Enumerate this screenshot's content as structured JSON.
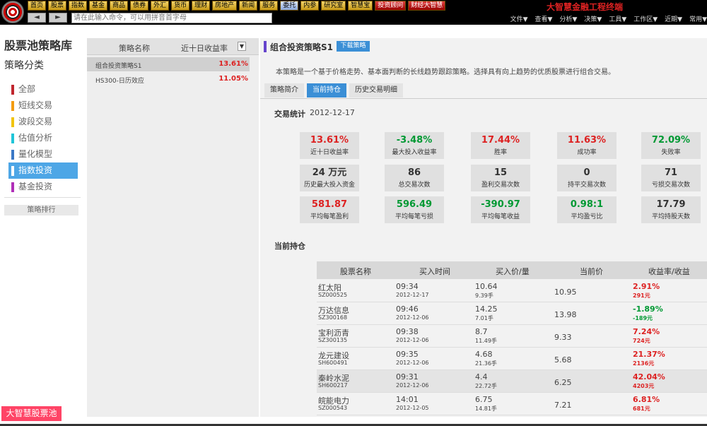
{
  "app": {
    "brand_title": "大智慧金融工程终端",
    "nav_buttons": [
      "首页",
      "股票",
      "指数",
      "基金",
      "商品",
      "债券",
      "外汇",
      "货币",
      "理财",
      "房地产",
      "新闻",
      "服务",
      "委托",
      "内参",
      "研究室",
      "智慧宝",
      "投资顾问",
      "财经大智慧"
    ],
    "command_placeholder": "请在此输入命令，可以用拼音首字母",
    "command_dropdown": "▼",
    "back_arrow": "◄",
    "forward_arrow": "►",
    "menus": [
      "文件▼",
      "查看▼",
      "分析▼",
      "决策▼",
      "工具▼",
      "工作区▼",
      "近期▼",
      "常用▼"
    ]
  },
  "sidebar": {
    "title": "股票池策略库",
    "category_title": "策略分类",
    "categories": [
      {
        "label": "全部",
        "color": "#c0262e"
      },
      {
        "label": "短线交易",
        "color": "#f39c12"
      },
      {
        "label": "波段交易",
        "color": "#f1c40f"
      },
      {
        "label": "估值分析",
        "color": "#1fc5d8"
      },
      {
        "label": "量化模型",
        "color": "#3a78c6"
      },
      {
        "label": "指数投资",
        "color": "#2e5fbf"
      },
      {
        "label": "基金投资",
        "color": "#b02fb8"
      }
    ],
    "rank_button": "策略排行",
    "pool_button": "大智慧股票池"
  },
  "list": {
    "col_name": "策略名称",
    "col_return": "近十日收益率",
    "sort_icon": "▼",
    "rows": [
      {
        "name": "组合投资策略S1",
        "ret": "13.61%"
      },
      {
        "name": "HS300-日历效应",
        "ret": "11.05%"
      }
    ]
  },
  "detail": {
    "title": "组合投资策略S1",
    "download_button": "下载策略",
    "description": "本策略是一个基于价格走势、基本面判断的长线趋势跟踪策略。选择具有向上趋势的优质股票进行组合交易。",
    "tabs": [
      "策略简介",
      "当前持仓",
      "历史交易明细"
    ],
    "stat_label": "交易统计",
    "stat_date": "2012-12-17",
    "stats": [
      {
        "val": "13.61%",
        "lbl": "近十日收益率",
        "cls": "red"
      },
      {
        "val": "-3.48%",
        "lbl": "最大投入收益率",
        "cls": "green"
      },
      {
        "val": "17.44%",
        "lbl": "胜率",
        "cls": "red"
      },
      {
        "val": "11.63%",
        "lbl": "成功率",
        "cls": "red"
      },
      {
        "val": "72.09%",
        "lbl": "失败率",
        "cls": "green"
      },
      {
        "val": "24 万元",
        "lbl": "历史最大投入资金",
        "cls": "dark"
      },
      {
        "val": "86",
        "lbl": "总交易次数",
        "cls": "dark"
      },
      {
        "val": "15",
        "lbl": "盈利交易次数",
        "cls": "dark"
      },
      {
        "val": "0",
        "lbl": "持平交易次数",
        "cls": "dark"
      },
      {
        "val": "71",
        "lbl": "亏损交易次数",
        "cls": "dark"
      },
      {
        "val": "581.87",
        "lbl": "平均每笔盈利",
        "cls": "red"
      },
      {
        "val": "596.49",
        "lbl": "平均每笔亏损",
        "cls": "green"
      },
      {
        "val": "-390.97",
        "lbl": "平均每笔收益",
        "cls": "green"
      },
      {
        "val": "0.98:1",
        "lbl": "平均盈亏比",
        "cls": "green"
      },
      {
        "val": "17.79",
        "lbl": "平均持股天数",
        "cls": "dark"
      }
    ],
    "holdings_label": "当前持仓",
    "holdings_headers": [
      "股票名称",
      "买入时间",
      "买入价/量",
      "当前价",
      "收益率/收益"
    ],
    "holdings": [
      {
        "name": "红太阳",
        "code": "SZ000525",
        "time": "09:34",
        "date": "2012-12-17",
        "price": "10.64",
        "qty": "9.39手",
        "cur": "10.95",
        "rate": "2.91%",
        "amt": "291元",
        "cls": "red"
      },
      {
        "name": "万达信息",
        "code": "SZ300168",
        "time": "09:46",
        "date": "2012-12-06",
        "price": "14.25",
        "qty": "7.01手",
        "cur": "13.98",
        "rate": "-1.89%",
        "amt": "-189元",
        "cls": "green"
      },
      {
        "name": "宝利沥青",
        "code": "SZ300135",
        "time": "09:38",
        "date": "2012-12-06",
        "price": "8.7",
        "qty": "11.49手",
        "cur": "9.33",
        "rate": "7.24%",
        "amt": "724元",
        "cls": "red"
      },
      {
        "name": "龙元建设",
        "code": "SH600491",
        "time": "09:35",
        "date": "2012-12-06",
        "price": "4.68",
        "qty": "21.36手",
        "cur": "5.68",
        "rate": "21.37%",
        "amt": "2136元",
        "cls": "red"
      },
      {
        "name": "秦岭水泥",
        "code": "SH600217",
        "time": "09:31",
        "date": "2012-12-06",
        "price": "4.4",
        "qty": "22.72手",
        "cur": "6.25",
        "rate": "42.04%",
        "amt": "4203元",
        "cls": "red"
      },
      {
        "name": "皖能电力",
        "code": "SZ000543",
        "time": "14:01",
        "date": "2012-12-05",
        "price": "6.75",
        "qty": "14.81手",
        "cur": "7.21",
        "rate": "6.81%",
        "amt": "681元",
        "cls": "red"
      }
    ]
  }
}
